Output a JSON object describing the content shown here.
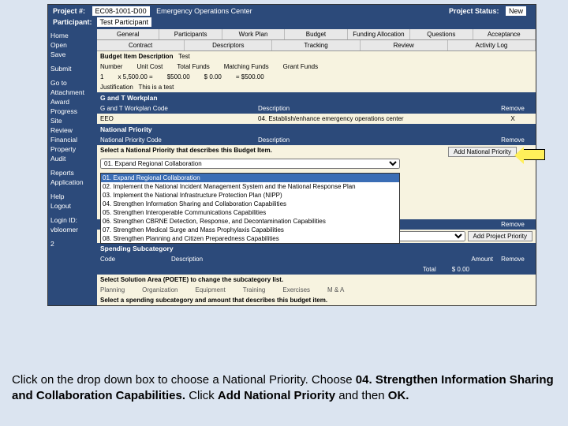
{
  "header": {
    "project_label": "Project #:",
    "project_value": "EC08-1001-D00",
    "project_name": "Emergency Operations Center",
    "participant_label": "Participant:",
    "participant_value": "Test Participant",
    "status_label": "Project Status:",
    "status_value": "New"
  },
  "sidebar": {
    "items": [
      "Home",
      "Open",
      "Save",
      "",
      "Submit",
      "",
      "Go to",
      "Attachment",
      "Award",
      "Progress",
      "Site",
      "Review",
      "Financial",
      "Property",
      "Audit",
      "",
      "Reports",
      "Application",
      "",
      "Help",
      "Logout",
      "",
      "Login ID:",
      "vbloomer",
      "",
      "2"
    ]
  },
  "tabs_row1": [
    "General",
    "Participants",
    "Work Plan",
    "Budget",
    "Funding Allocation",
    "Questions",
    "Acceptance"
  ],
  "tabs_row2": [
    "Contract",
    "Descriptors",
    "Tracking",
    "Review",
    "Activity Log"
  ],
  "budget": {
    "head": "Budget Item Description",
    "head_val": "Test",
    "cols": [
      "Number",
      "Unit Cost",
      "Total Funds",
      "Matching Funds",
      "Grant Funds"
    ],
    "vals": [
      "1",
      "x   5,500.00  =",
      "$500.00",
      "$ 0.00",
      "=   $500.00"
    ],
    "just_label": "Justification",
    "just_val": "This is a test"
  },
  "workplan": {
    "title": "G and T Workplan",
    "code_head": "G and T Workplan Code",
    "desc_head": "Description",
    "remove_head": "Remove",
    "code": "EEO",
    "desc": "04. Establish/enhance emergency operations center",
    "x": "X"
  },
  "natpriority": {
    "title": "National Priority",
    "code_head": "National Priority Code",
    "desc_head": "Description",
    "remove_head": "Remove",
    "prompt": "Select a National Priority that describes this Budget Item.",
    "options": [
      "01. Expand Regional Collaboration",
      "02. Implement the National Incident Management System and the National Response Plan",
      "03. Implement the National Infrastructure Protection Plan (NIPP)",
      "04. Strengthen Information Sharing and Collaboration Capabilities",
      "05. Strengthen Interoperable Communications Capabilities",
      "06. Strengthen CBRNE Detection, Response, and Decontamination Capabilities",
      "07. Strengthen Medical Surge and Mass Prophylaxis Capabilities",
      "08. Strengthen Planning and Citizen Preparedness Capabilities"
    ],
    "add_btn": "Add National Priority",
    "add_proj_btn": "Add Project Priority"
  },
  "spend": {
    "title": "Spending Subcategory",
    "code_head": "Code",
    "desc_head": "Description",
    "amt_head": "Amount",
    "remove_head": "Remove",
    "total_label": "Total",
    "total_val": "$ 0.00",
    "poete_prompt": "Select Solution Area (POETE) to change the subcategory list.",
    "poete": [
      "Planning",
      "Organization",
      "Equipment",
      "Training",
      "Exercises",
      "M & A"
    ],
    "final_prompt": "Select a spending subcategory and amount that describes this budget item."
  },
  "instruction": {
    "p1a": "Click on the drop down box to choose a National Priority.  Choose ",
    "p1b": "04. Strengthen Information Sharing and Collaboration Capabilities.",
    "p1c": "  Click ",
    "p1d": "Add National Priority",
    "p1e": " and then ",
    "p1f": "OK."
  }
}
